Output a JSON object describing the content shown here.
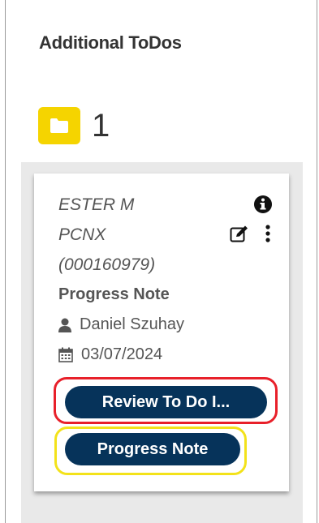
{
  "section": {
    "title": "Additional ToDos",
    "count": "1",
    "folder_icon": "folder-icon",
    "badge_color": "#f5d400"
  },
  "card": {
    "patient_name": "ESTER M",
    "patient_line2": "PCNX",
    "patient_id": "(000160979)",
    "document_type": "Progress Note",
    "author": "Daniel Szuhay",
    "date": "03/07/2024",
    "icons": [
      "info-icon",
      "edit-icon",
      "more-options-icon",
      "user-icon",
      "calendar-icon"
    ],
    "buttons": {
      "review_label": "Review To Do I...",
      "progress_label": "Progress Note"
    },
    "button_color": "#06335a"
  },
  "highlights": {
    "review_color": "#e8202a",
    "progress_color": "#f3e21a"
  }
}
